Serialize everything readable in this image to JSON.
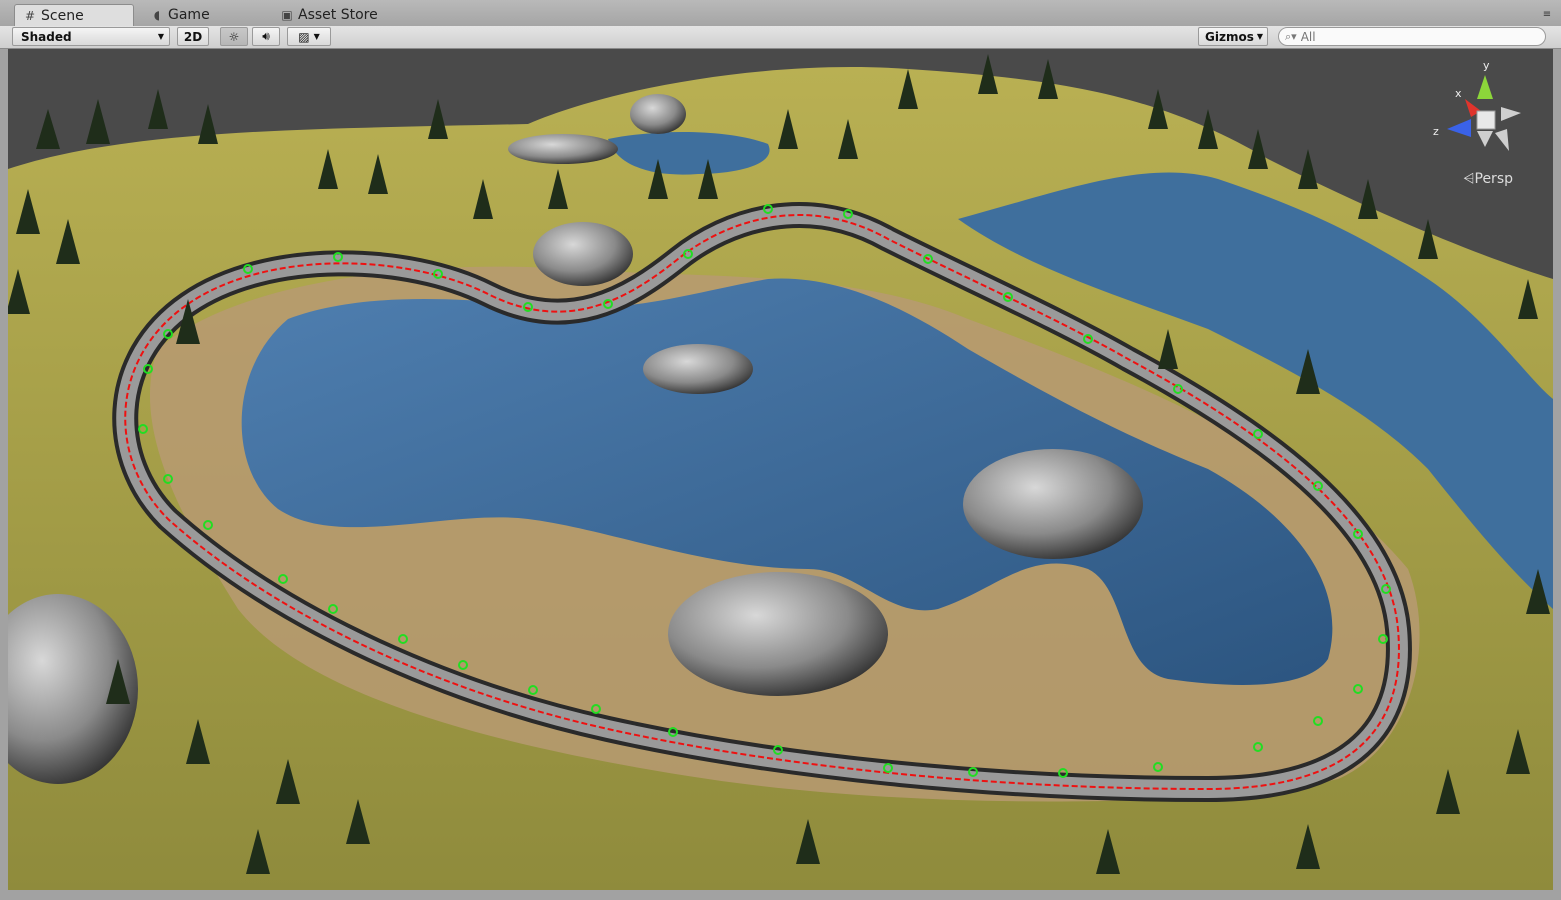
{
  "tabs": [
    {
      "label": "Scene",
      "icon": "grid-icon"
    },
    {
      "label": "Game",
      "icon": "pacman-icon"
    },
    {
      "label": "Asset Store",
      "icon": "shopping-bag-icon"
    }
  ],
  "toolbar": {
    "shading_mode": "Shaded",
    "mode_2d": "2D",
    "lighting_icon": "sun-icon",
    "audio_icon": "speaker-icon",
    "effects_icon": "image-icon",
    "gizmos_label": "Gizmos",
    "search_placeholder": "All"
  },
  "gizmo": {
    "projection": "Persp",
    "axes": {
      "x": "x",
      "y": "y",
      "z": "z"
    },
    "colors": {
      "x": "#e0342c",
      "y": "#8cd63a",
      "z": "#3a62e8"
    }
  },
  "scene": {
    "description_colors": {
      "water": "#3f6f9d",
      "grass": "#a9a44a",
      "road": "#666666",
      "waypoint": "#22dd22",
      "path": "#ee1111"
    }
  }
}
